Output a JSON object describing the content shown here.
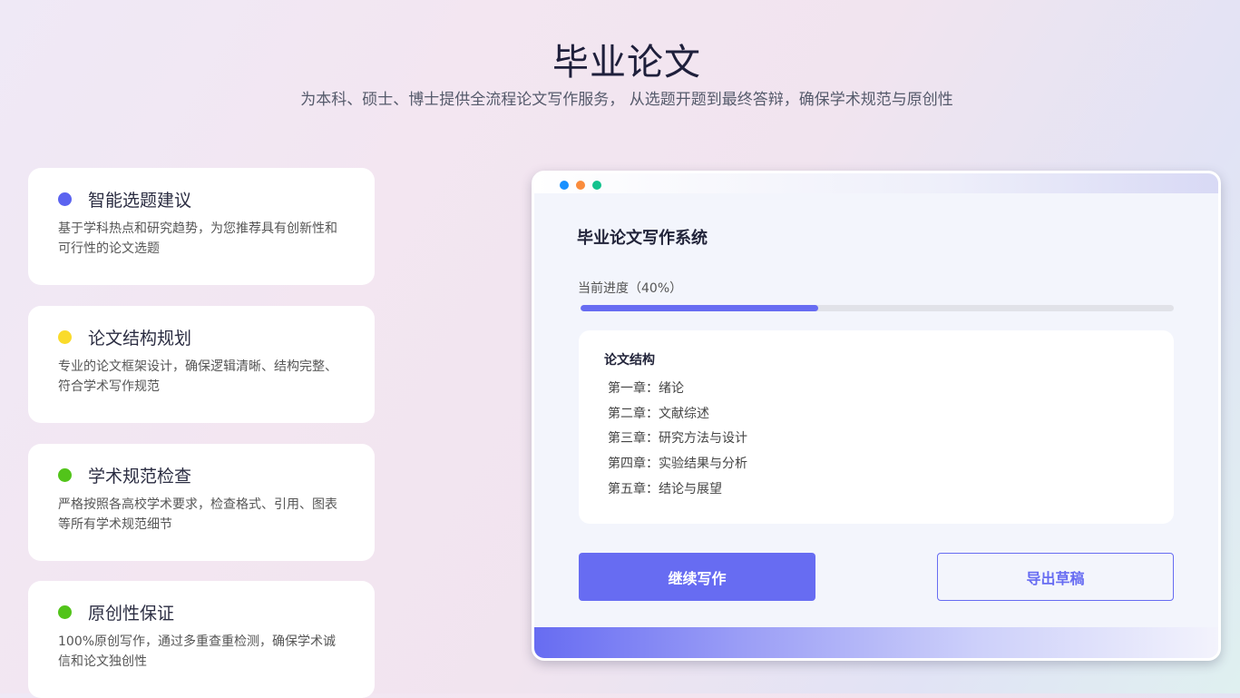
{
  "header": {
    "title": "毕业论文",
    "subtitle": "为本科、硕士、博士提供全流程论文写作服务， 从选题开题到最终答辩，确保学术规范与原创性"
  },
  "features": [
    {
      "title": "智能选题建议",
      "desc": "基于学科热点和研究趋势，为您推荐具有创新性和可行性的论文选题",
      "color": "#5b63f0"
    },
    {
      "title": "论文结构规划",
      "desc": "专业的论文框架设计，确保逻辑清晰、结构完整、符合学术写作规范",
      "color": "#fadb2b"
    },
    {
      "title": "学术规范检查",
      "desc": "严格按照各高校学术要求，检查格式、引用、图表等所有学术规范细节",
      "color": "#52c41a"
    },
    {
      "title": "原创性保证",
      "desc": "100%原创写作，通过多重查重检测，确保学术诚信和论文独创性",
      "color": "#52c41a"
    }
  ],
  "window": {
    "dots": [
      "#1890ff",
      "#fa8c3c",
      "#13c28d"
    ],
    "title": "毕业论文写作系统",
    "progress_label": "当前进度（40%）",
    "progress": 0.4,
    "outline_title": "论文结构",
    "chapters": [
      "第一章：绪论",
      "第二章：文献综述",
      "第三章：研究方法与设计",
      "第四章：实验结果与分析",
      "第五章：结论与展望"
    ],
    "primary_button": "继续写作",
    "secondary_button": "导出草稿",
    "accent_color": "#676cf2"
  }
}
